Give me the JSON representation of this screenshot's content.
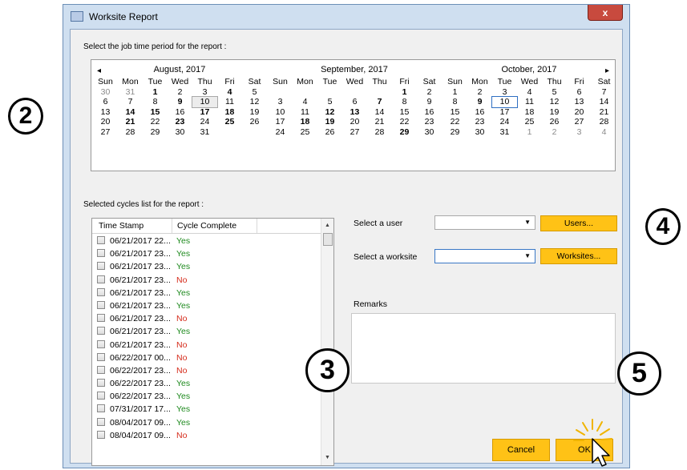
{
  "window": {
    "title": "Worksite Report",
    "close_glyph": "x"
  },
  "callouts": {
    "c2": "2",
    "c3": "3",
    "c4": "4",
    "c5": "5"
  },
  "period_label": "Select the job time period for the report :",
  "calendar": {
    "prev_glyph": "◂",
    "next_glyph": "▸",
    "day_headers": [
      "Sun",
      "Mon",
      "Tue",
      "Wed",
      "Thu",
      "Fri",
      "Sat"
    ],
    "months": [
      {
        "title": "August, 2017",
        "days": [
          {
            "d": "30",
            "s": "grey"
          },
          {
            "d": "31",
            "s": "grey"
          },
          {
            "d": "1",
            "s": "bold"
          },
          {
            "d": "2",
            "s": ""
          },
          {
            "d": "3",
            "s": ""
          },
          {
            "d": "4",
            "s": "bold"
          },
          {
            "d": "5",
            "s": ""
          },
          {
            "d": "6",
            "s": ""
          },
          {
            "d": "7",
            "s": ""
          },
          {
            "d": "8",
            "s": ""
          },
          {
            "d": "9",
            "s": "bold"
          },
          {
            "d": "10",
            "s": "today"
          },
          {
            "d": "11",
            "s": ""
          },
          {
            "d": "12",
            "s": ""
          },
          {
            "d": "13",
            "s": ""
          },
          {
            "d": "14",
            "s": "bold"
          },
          {
            "d": "15",
            "s": "bold"
          },
          {
            "d": "16",
            "s": ""
          },
          {
            "d": "17",
            "s": "bold"
          },
          {
            "d": "18",
            "s": "bold"
          },
          {
            "d": "19",
            "s": ""
          },
          {
            "d": "20",
            "s": ""
          },
          {
            "d": "21",
            "s": "bold"
          },
          {
            "d": "22",
            "s": ""
          },
          {
            "d": "23",
            "s": "bold"
          },
          {
            "d": "24",
            "s": ""
          },
          {
            "d": "25",
            "s": "bold"
          },
          {
            "d": "26",
            "s": ""
          },
          {
            "d": "27",
            "s": ""
          },
          {
            "d": "28",
            "s": ""
          },
          {
            "d": "29",
            "s": ""
          },
          {
            "d": "30",
            "s": ""
          },
          {
            "d": "31",
            "s": ""
          },
          {
            "d": "",
            "s": ""
          },
          {
            "d": "",
            "s": ""
          }
        ]
      },
      {
        "title": "September, 2017",
        "days": [
          {
            "d": "",
            "s": ""
          },
          {
            "d": "",
            "s": ""
          },
          {
            "d": "",
            "s": ""
          },
          {
            "d": "",
            "s": ""
          },
          {
            "d": "",
            "s": ""
          },
          {
            "d": "1",
            "s": "bold"
          },
          {
            "d": "2",
            "s": ""
          },
          {
            "d": "3",
            "s": ""
          },
          {
            "d": "4",
            "s": ""
          },
          {
            "d": "5",
            "s": ""
          },
          {
            "d": "6",
            "s": ""
          },
          {
            "d": "7",
            "s": "bold"
          },
          {
            "d": "8",
            "s": ""
          },
          {
            "d": "9",
            "s": ""
          },
          {
            "d": "10",
            "s": ""
          },
          {
            "d": "11",
            "s": ""
          },
          {
            "d": "12",
            "s": "bold"
          },
          {
            "d": "13",
            "s": "bold"
          },
          {
            "d": "14",
            "s": ""
          },
          {
            "d": "15",
            "s": ""
          },
          {
            "d": "16",
            "s": ""
          },
          {
            "d": "17",
            "s": ""
          },
          {
            "d": "18",
            "s": "bold"
          },
          {
            "d": "19",
            "s": "bold"
          },
          {
            "d": "20",
            "s": ""
          },
          {
            "d": "21",
            "s": ""
          },
          {
            "d": "22",
            "s": ""
          },
          {
            "d": "23",
            "s": ""
          },
          {
            "d": "24",
            "s": ""
          },
          {
            "d": "25",
            "s": ""
          },
          {
            "d": "26",
            "s": ""
          },
          {
            "d": "27",
            "s": ""
          },
          {
            "d": "28",
            "s": ""
          },
          {
            "d": "29",
            "s": "bold"
          },
          {
            "d": "30",
            "s": ""
          }
        ]
      },
      {
        "title": "October, 2017",
        "days": [
          {
            "d": "1",
            "s": ""
          },
          {
            "d": "2",
            "s": ""
          },
          {
            "d": "3",
            "s": ""
          },
          {
            "d": "4",
            "s": ""
          },
          {
            "d": "5",
            "s": ""
          },
          {
            "d": "6",
            "s": ""
          },
          {
            "d": "7",
            "s": ""
          },
          {
            "d": "8",
            "s": ""
          },
          {
            "d": "9",
            "s": "bold"
          },
          {
            "d": "10",
            "s": "selected"
          },
          {
            "d": "11",
            "s": ""
          },
          {
            "d": "12",
            "s": ""
          },
          {
            "d": "13",
            "s": ""
          },
          {
            "d": "14",
            "s": ""
          },
          {
            "d": "15",
            "s": ""
          },
          {
            "d": "16",
            "s": ""
          },
          {
            "d": "17",
            "s": ""
          },
          {
            "d": "18",
            "s": ""
          },
          {
            "d": "19",
            "s": ""
          },
          {
            "d": "20",
            "s": ""
          },
          {
            "d": "21",
            "s": ""
          },
          {
            "d": "22",
            "s": ""
          },
          {
            "d": "23",
            "s": ""
          },
          {
            "d": "24",
            "s": ""
          },
          {
            "d": "25",
            "s": ""
          },
          {
            "d": "26",
            "s": ""
          },
          {
            "d": "27",
            "s": ""
          },
          {
            "d": "28",
            "s": ""
          },
          {
            "d": "29",
            "s": ""
          },
          {
            "d": "30",
            "s": ""
          },
          {
            "d": "31",
            "s": ""
          },
          {
            "d": "1",
            "s": "grey"
          },
          {
            "d": "2",
            "s": "grey"
          },
          {
            "d": "3",
            "s": "grey"
          },
          {
            "d": "4",
            "s": "grey"
          }
        ]
      }
    ]
  },
  "cycles_label": "Selected cycles list for the report :",
  "cycles_list": {
    "columns": [
      "Time Stamp",
      "Cycle Complete"
    ],
    "rows": [
      {
        "ts": "06/21/2017 22...",
        "cc": "Yes"
      },
      {
        "ts": "06/21/2017 23...",
        "cc": "Yes"
      },
      {
        "ts": "06/21/2017 23...",
        "cc": "Yes"
      },
      {
        "ts": "06/21/2017 23...",
        "cc": "No"
      },
      {
        "ts": "06/21/2017 23...",
        "cc": "Yes"
      },
      {
        "ts": "06/21/2017 23...",
        "cc": "Yes"
      },
      {
        "ts": "06/21/2017 23...",
        "cc": "No"
      },
      {
        "ts": "06/21/2017 23...",
        "cc": "Yes"
      },
      {
        "ts": "06/21/2017 23...",
        "cc": "No"
      },
      {
        "ts": "06/22/2017 00...",
        "cc": "No"
      },
      {
        "ts": "06/22/2017 23...",
        "cc": "No"
      },
      {
        "ts": "06/22/2017 23...",
        "cc": "Yes"
      },
      {
        "ts": "06/22/2017 23...",
        "cc": "Yes"
      },
      {
        "ts": "07/31/2017 17...",
        "cc": "Yes"
      },
      {
        "ts": "08/04/2017 09...",
        "cc": "Yes"
      },
      {
        "ts": "08/04/2017 09...",
        "cc": "No"
      }
    ]
  },
  "user_select": {
    "label": "Select a user",
    "value": "",
    "button": "Users..."
  },
  "worksite_select": {
    "label": "Select a worksite",
    "value": "",
    "button": "Worksites..."
  },
  "remarks": {
    "label": "Remarks",
    "value": ""
  },
  "buttons": {
    "cancel": "Cancel",
    "ok": "OK"
  },
  "colors": {
    "accent_button": "#ffc216",
    "yes": "#1f8a1f",
    "no": "#d52a1a",
    "window_frame": "#cfdff0"
  }
}
